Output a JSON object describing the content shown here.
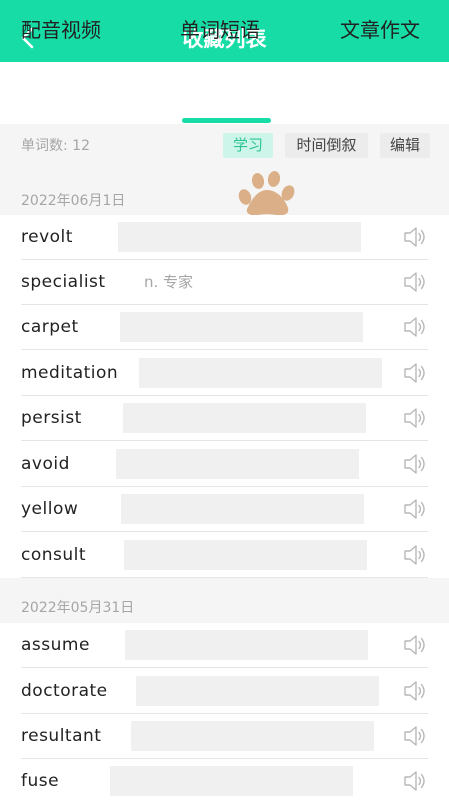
{
  "header": {
    "title": "收藏列表"
  },
  "tabs": [
    {
      "label": "配音视频"
    },
    {
      "label": "单词短语"
    },
    {
      "label": "文章作文"
    }
  ],
  "toolbar": {
    "word_count": "单词数: 12",
    "study_label": "学习",
    "sort_label": "时间倒叙",
    "edit_label": "编辑"
  },
  "groups": [
    {
      "date": "2022年06月1日",
      "words": [
        {
          "word": "revolt",
          "meaning": ""
        },
        {
          "word": "specialist",
          "meaning": "n. 专家"
        },
        {
          "word": "carpet",
          "meaning": ""
        },
        {
          "word": "meditation",
          "meaning": ""
        },
        {
          "word": "persist",
          "meaning": ""
        },
        {
          "word": "avoid",
          "meaning": ""
        },
        {
          "word": "yellow",
          "meaning": ""
        },
        {
          "word": "consult",
          "meaning": ""
        }
      ]
    },
    {
      "date": "2022年05月31日",
      "words": [
        {
          "word": "assume",
          "meaning": ""
        },
        {
          "word": "doctorate",
          "meaning": ""
        },
        {
          "word": "resultant",
          "meaning": ""
        },
        {
          "word": "fuse",
          "meaning": ""
        }
      ]
    }
  ],
  "colors": {
    "accent": "#17dca6",
    "paw": "#dbb088",
    "mask": "#f0f0f0"
  },
  "icons": {
    "back": "chevron-left-icon",
    "speaker": "speaker-icon",
    "paw": "paw-icon"
  }
}
